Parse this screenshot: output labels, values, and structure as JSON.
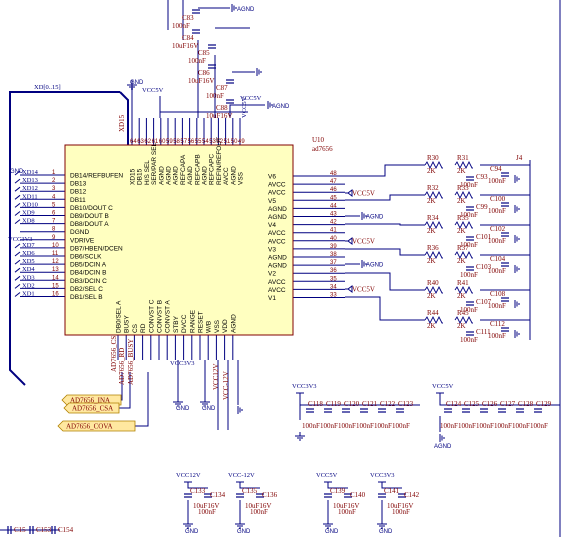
{
  "chip": {
    "designator": "U10",
    "part": "ad7656",
    "left_pins": [
      {
        "num": "1",
        "name": "DB14/REFBUFEN",
        "net": "XD14"
      },
      {
        "num": "2",
        "name": "DB13",
        "net": "XD13"
      },
      {
        "num": "3",
        "name": "DB12",
        "net": "XD12"
      },
      {
        "num": "4",
        "name": "DB11",
        "net": "XD11"
      },
      {
        "num": "5",
        "name": "DB10/DOUT C",
        "net": "XD10"
      },
      {
        "num": "6",
        "name": "DB9/DOUT B",
        "net": "XD9"
      },
      {
        "num": "7",
        "name": "DB8/DOUT A",
        "net": "XD8"
      },
      {
        "num": "8",
        "name": "DGND",
        "net": "GND"
      },
      {
        "num": "9",
        "name": "VDRIVE",
        "net": "VCC3V3"
      },
      {
        "num": "10",
        "name": "DB7/HBEN/DCEN",
        "net": "XD7"
      },
      {
        "num": "11",
        "name": "DB6/SCLK",
        "net": "XD6"
      },
      {
        "num": "12",
        "name": "DB5/DCIN A",
        "net": "XD5"
      },
      {
        "num": "13",
        "name": "DB4/DCIN B",
        "net": "XD4"
      },
      {
        "num": "14",
        "name": "DB3/DCIN C",
        "net": "XD3"
      },
      {
        "num": "15",
        "name": "DB2/SEL C",
        "net": "XD2"
      },
      {
        "num": "16",
        "name": "DB1/SEL B",
        "net": "XD1"
      }
    ],
    "right_pins": [
      {
        "num": "48",
        "name": "V6"
      },
      {
        "num": "47",
        "name": "AVCC"
      },
      {
        "num": "46",
        "name": "AVCC"
      },
      {
        "num": "45",
        "name": "V5"
      },
      {
        "num": "44",
        "name": "AGND"
      },
      {
        "num": "43",
        "name": "AGND"
      },
      {
        "num": "42",
        "name": "V4"
      },
      {
        "num": "41",
        "name": "AVCC"
      },
      {
        "num": "40",
        "name": "AVCC"
      },
      {
        "num": "39",
        "name": "V3"
      },
      {
        "num": "38",
        "name": "AGND"
      },
      {
        "num": "37",
        "name": "AGND"
      },
      {
        "num": "36",
        "name": "V2"
      },
      {
        "num": "35",
        "name": "AVCC"
      },
      {
        "num": "34",
        "name": "AVCC"
      },
      {
        "num": "33",
        "name": "V1"
      }
    ],
    "top_pins": [
      "XD15",
      "DB15",
      "H/S SEL",
      "SER/PAR SEL",
      "AGND",
      "AGND",
      "AGND",
      "REFCAPA",
      "AGND",
      "REFCAPB",
      "AGND",
      "REFCAPC",
      "REFIN/REFOUT",
      "AVCC",
      "AGND",
      "VSS"
    ],
    "bottom_pins": [
      "DB0/SEL A",
      "BUSY",
      "CS",
      "RD",
      "CONVST C",
      "CONVST B",
      "CONVST A",
      "STBY",
      "DVCC",
      "RANGE",
      "RESET",
      "W/B",
      "VSS",
      "VDD",
      "AGND"
    ]
  },
  "nets": {
    "bus": "XD[0..15]",
    "vcc5v": "VCC5V",
    "vcc3v3": "VCC3V3",
    "vcc12v": "VCC12V",
    "vccm12v": "VCC-12V",
    "agnd": "AGND",
    "gnd": "GND",
    "xdis": "XD15",
    "ad_cs": "AD7656_CS",
    "ad_rd": "AD7656_RD",
    "ad_busy": "AD7656_BUSY",
    "port_ina": "AD7656_INA",
    "port_csa": "AD7656_CSA",
    "port_cova": "AD7656_COVA",
    "vcc12v_pin": "VCC12V",
    "vccm12v_pin": "VCC-12V",
    "vcc3v3_pin": "VCC3V3"
  },
  "top_caps": [
    {
      "ref": "C83",
      "value": "100nF"
    },
    {
      "ref": "C84",
      "value": "10uF16V"
    },
    {
      "ref": "C85",
      "value": "100nF"
    },
    {
      "ref": "C86",
      "value": "10uF16V"
    },
    {
      "ref": "C87",
      "value": "100nF"
    },
    {
      "ref": "C88",
      "value": "10uF16V"
    }
  ],
  "filters": [
    {
      "r1": "R30",
      "r1v": "2K",
      "r2": "R31",
      "r2v": "2K",
      "c": "C93",
      "cv": "100nF",
      "c2": "C94",
      "c2v": "100nF"
    },
    {
      "r1": "R32",
      "r1v": "2K",
      "r2": "R33",
      "r2v": "2K",
      "c": "C99",
      "cv": "100nF",
      "c2": "C100",
      "c2v": "100nF"
    },
    {
      "r1": "R34",
      "r1v": "2K",
      "r2": "R35",
      "r2v": "2K",
      "c": "C101",
      "cv": "100nF",
      "c2": "C102",
      "c2v": "100nF"
    },
    {
      "r1": "R36",
      "r1v": "2K",
      "r2": "R37",
      "r2v": "2K",
      "c": "C103",
      "cv": "100nF",
      "c2": "C104",
      "c2v": "100nF"
    },
    {
      "r1": "R40",
      "r1v": "2K",
      "r2": "R41",
      "r2v": "2K",
      "c": "C107",
      "cv": "100nF",
      "c2": "C108",
      "c2v": "100nF"
    },
    {
      "r1": "R44",
      "r1v": "2K",
      "r2": "R45",
      "r2v": "2K",
      "c": "C111",
      "cv": "100nF",
      "c2": "C112",
      "c2v": "100nF"
    }
  ],
  "connector": "J4",
  "decouple_left": [
    {
      "ref": "C118",
      "value": "100nF"
    },
    {
      "ref": "C119",
      "value": "100nF"
    },
    {
      "ref": "C120",
      "value": "100nF"
    },
    {
      "ref": "C121",
      "value": "100nF"
    },
    {
      "ref": "C122",
      "value": "100nF"
    },
    {
      "ref": "C123",
      "value": "100nF"
    }
  ],
  "decouple_right": [
    {
      "ref": "C124",
      "value": "100nF"
    },
    {
      "ref": "C125",
      "value": "100nF"
    },
    {
      "ref": "C126",
      "value": "100nF"
    },
    {
      "ref": "C127",
      "value": "100nF"
    },
    {
      "ref": "C128",
      "value": "100nF"
    },
    {
      "ref": "C129",
      "value": "100nF"
    }
  ],
  "bulk_caps": [
    {
      "net": "VCC12V",
      "c1": "C133",
      "c1v": "100nF",
      "c2": "C134",
      "c2v": "10uF16V"
    },
    {
      "net": "VCC-12V",
      "c1": "C135",
      "c1v": "100nF",
      "c2": "C136",
      "c2v": "10uF16V"
    },
    {
      "net": "VCC5V",
      "c1": "C139",
      "c1v": "100nF",
      "c2": "C140",
      "c2v": "10uF16V"
    },
    {
      "net": "VCC3V3",
      "c1": "C141",
      "c1v": "100nF",
      "c2": "C142",
      "c2v": "10uF16V"
    }
  ],
  "bottom_left_caps": [
    {
      "ref": "C15"
    },
    {
      "ref": "C153"
    },
    {
      "ref": "C154"
    }
  ],
  "colors": {
    "wire": "#000080",
    "body_fill": "#ffffc0",
    "body_stroke": "#800000",
    "port_fill": "#ffe8a0",
    "port_stroke": "#b08000"
  }
}
